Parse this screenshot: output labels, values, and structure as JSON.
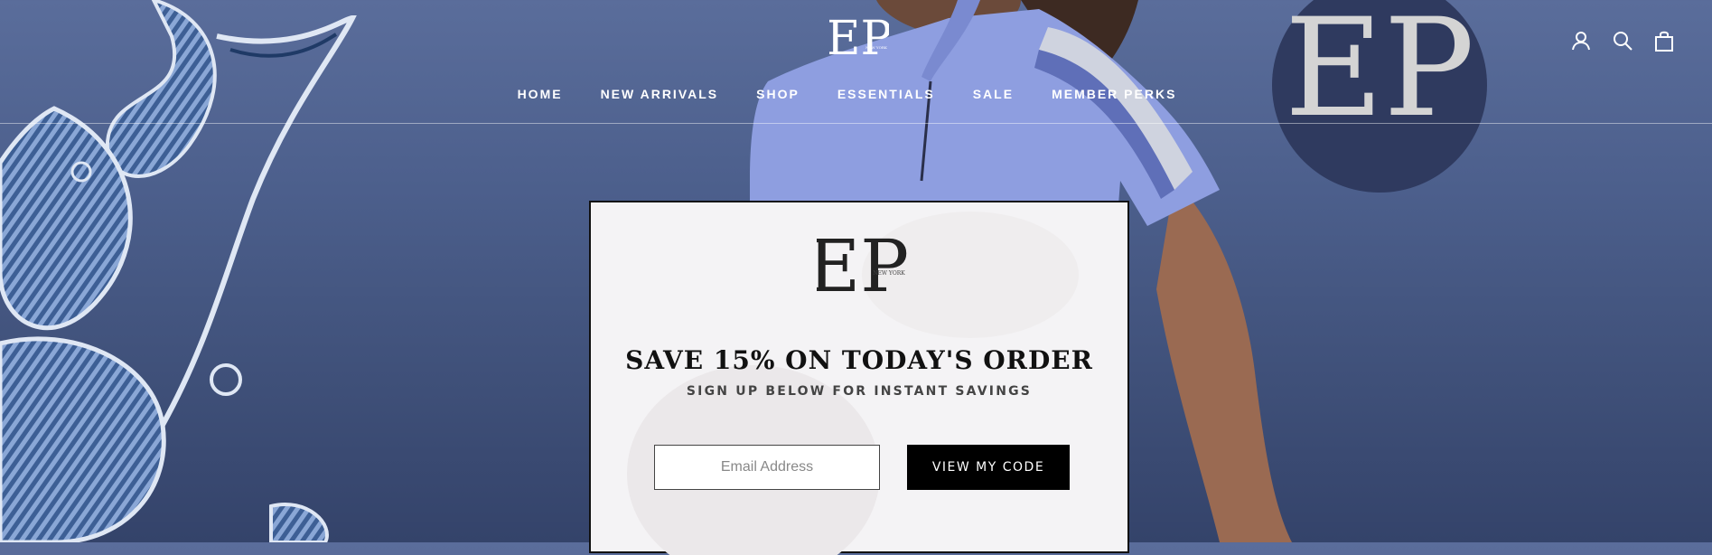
{
  "nav": {
    "items": [
      {
        "label": "HOME"
      },
      {
        "label": "NEW ARRIVALS"
      },
      {
        "label": "SHOP"
      },
      {
        "label": "ESSENTIALS"
      },
      {
        "label": "SALE"
      },
      {
        "label": "MEMBER PERKS"
      }
    ]
  },
  "brand": {
    "logo_letters": "EP",
    "logo_tagline": "NEW YORK"
  },
  "header_icons": [
    "account-icon",
    "search-icon",
    "cart-icon"
  ],
  "popup": {
    "title": "SAVE 15% ON TODAY'S ORDER",
    "subtitle": "SIGN UP BELOW FOR INSTANT SAVINGS",
    "email_placeholder": "Email Address",
    "cta_label": "VIEW MY CODE"
  },
  "colors": {
    "hero_bg": "#4c5f8c",
    "badge_bg": "#2f3a5f",
    "shirt": "#8e9ee0",
    "cta_bg": "#000000",
    "popup_bg": "#f4f3f5"
  }
}
